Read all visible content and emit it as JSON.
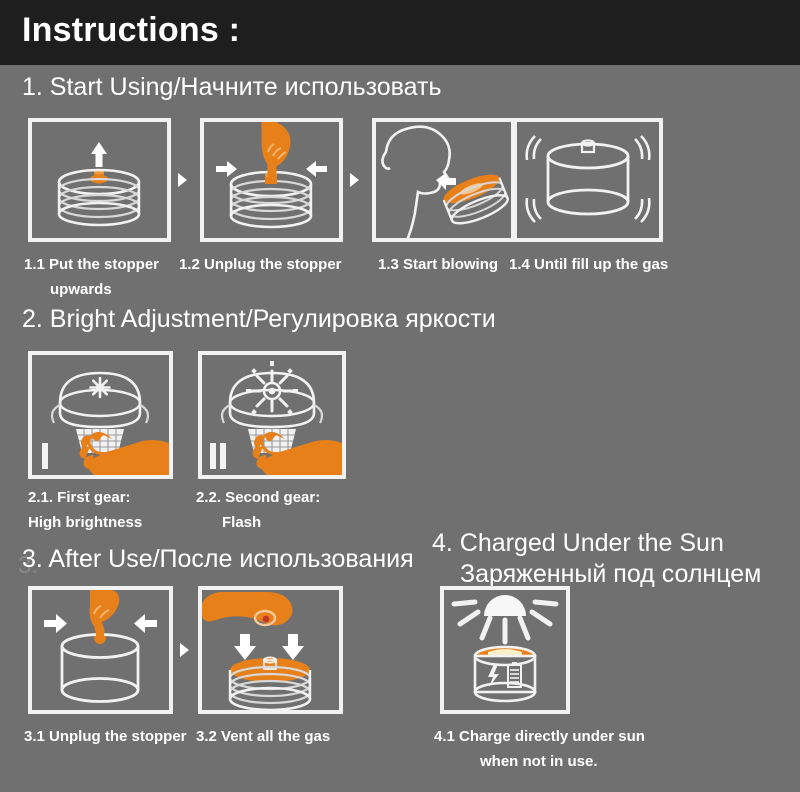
{
  "header": {
    "title": "Instructions :",
    "bg_color": "#1e1e1e",
    "text_color": "#ffffff"
  },
  "theme": {
    "background": "#707070",
    "line_color": "#f2f2f2",
    "accent_orange": "#e8801a",
    "accent_orange_dark": "#d4660d",
    "text_color": "#ffffff"
  },
  "sections": [
    {
      "id": "section-1",
      "heading": "1. Start Using/Начните использовать",
      "steps": [
        {
          "id": "step-1-1",
          "caption_line1": "1.1  Put the stopper",
          "caption_line2": "upwards",
          "icon": "collapsed-lantern-up-arrow-icon"
        },
        {
          "id": "step-1-2",
          "caption_line1": "1.2 Unplug the stopper",
          "caption_line2": "",
          "icon": "hand-unplug-stopper-icon"
        },
        {
          "id": "step-1-3",
          "caption_line1": "1.3  Start blowing",
          "caption_line2": "",
          "icon": "head-blowing-lantern-icon"
        },
        {
          "id": "step-1-4",
          "caption_line1": "1.4 Until fill up the gas",
          "caption_line2": "",
          "icon": "inflated-cylinder-icon"
        }
      ]
    },
    {
      "id": "section-2",
      "heading": "2. Bright Adjustment/Регулировка яркости",
      "steps": [
        {
          "id": "step-2-1",
          "caption_line1": "2.1. First gear:",
          "caption_line2": "High brightness",
          "gear_marker": "I",
          "icon": "lantern-high-brightness-icon"
        },
        {
          "id": "step-2-2",
          "caption_line1": "2.2. Second gear:",
          "caption_line2": "Flash",
          "gear_marker": "II",
          "icon": "lantern-flash-mode-icon"
        }
      ]
    },
    {
      "id": "section-3",
      "heading": "3. After Use/После использования",
      "steps": [
        {
          "id": "step-3-1",
          "caption_line1": "3.1 Unplug the stopper",
          "caption_line2": "",
          "icon": "hand-unplug-inflated-icon"
        },
        {
          "id": "step-3-2",
          "caption_line1": "3.2 Vent all the gas",
          "caption_line2": "",
          "icon": "hand-press-deflate-icon"
        }
      ]
    },
    {
      "id": "section-4",
      "heading_line1": "4. Charged Under the Sun",
      "heading_line2": "Заряженный под солнцем",
      "steps": [
        {
          "id": "step-4-1",
          "caption_line1": "4.1 Charge directly under sun",
          "caption_line2": "when not in use.",
          "icon": "sun-charging-lantern-icon"
        }
      ]
    }
  ],
  "separators": {
    "glyph": "triangle-right-icon",
    "count": 4
  }
}
